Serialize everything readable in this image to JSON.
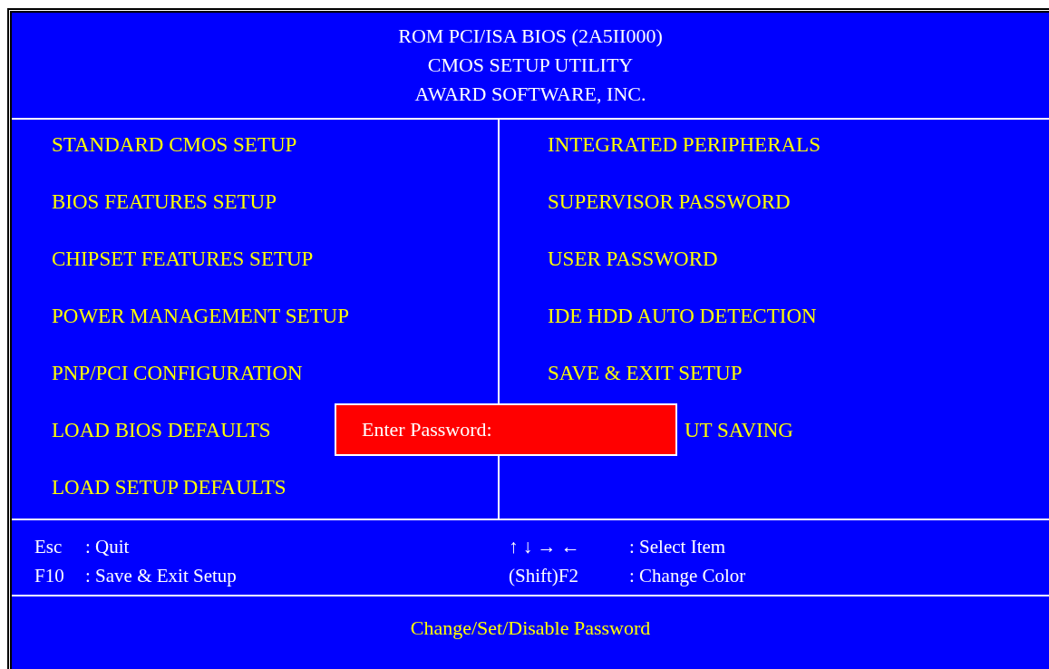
{
  "header": {
    "lines": [
      "ROM PCI/ISA BIOS (2A5II000)",
      "CMOS SETUP UTILITY",
      "AWARD SOFTWARE, INC."
    ]
  },
  "menu": {
    "left": [
      {
        "label": "STANDARD CMOS SETUP"
      },
      {
        "label": "BIOS FEATURES SETUP"
      },
      {
        "label": "CHIPSET FEATURES SETUP"
      },
      {
        "label": "POWER MANAGEMENT SETUP"
      },
      {
        "label": "PNP/PCI CONFIGURATION"
      },
      {
        "label": "LOAD BIOS DEFAULTS"
      },
      {
        "label": "LOAD SETUP DEFAULTS"
      }
    ],
    "right": [
      {
        "label": "INTEGRATED PERIPHERALS",
        "kind": "full"
      },
      {
        "label": "SUPERVISOR PASSWORD",
        "kind": "full"
      },
      {
        "label": "USER PASSWORD",
        "kind": "full"
      },
      {
        "label": "IDE HDD AUTO DETECTION",
        "kind": "full"
      },
      {
        "label": "SAVE & EXIT SETUP",
        "kind": "full"
      },
      {
        "label": "UT SAVING",
        "kind": "covered"
      }
    ]
  },
  "dialog": {
    "label": "Enter Password:"
  },
  "key_help": {
    "left": [
      {
        "key": "Esc",
        "action": ": Quit"
      },
      {
        "key": "F10",
        "action": ": Save & Exit Setup"
      }
    ],
    "right": [
      {
        "key": "↑ ↓ → ←",
        "action": ": Select Item"
      },
      {
        "key": "(Shift)F2",
        "action": ": Change Color"
      }
    ]
  },
  "status_bar": {
    "text": "Change/Set/Disable Password"
  }
}
